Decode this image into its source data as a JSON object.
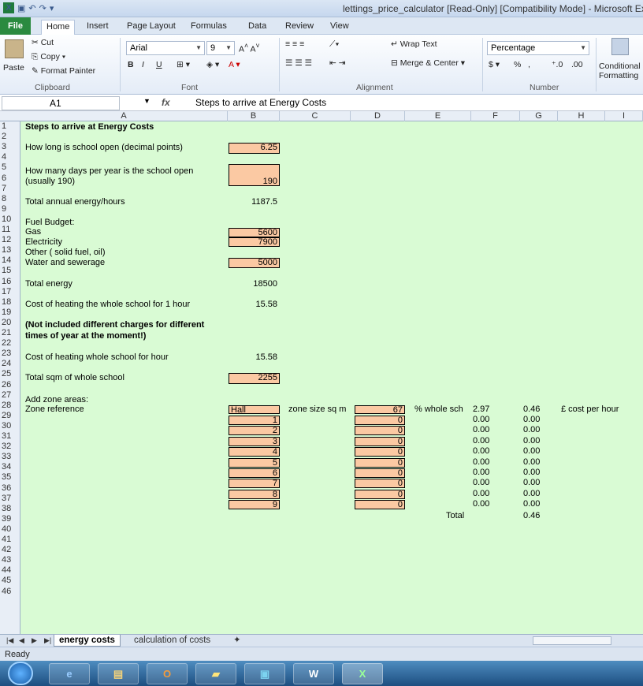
{
  "title": "lettings_price_calculator  [Read-Only]  [Compatibility Mode]  -  Microsoft Ex",
  "tabs": [
    "File",
    "Home",
    "Insert",
    "Page Layout",
    "Formulas",
    "Data",
    "Review",
    "View"
  ],
  "clipboard": {
    "cut": "Cut",
    "copy": "Copy",
    "paste": "Paste",
    "painter": "Format Painter",
    "label": "Clipboard"
  },
  "font": {
    "name": "Arial",
    "size": "9",
    "label": "Font",
    "bold": "B",
    "italic": "I",
    "underline": "U"
  },
  "alignment": {
    "wrap": "Wrap Text",
    "merge": "Merge & Center",
    "label": "Alignment"
  },
  "number": {
    "format": "Percentage",
    "label": "Number",
    "pct": "%"
  },
  "styles": {
    "cond": "Conditional",
    "cond2": "Formatting"
  },
  "namebox": "A1",
  "fx": "fx",
  "formula": "Steps to arrive at Energy Costs",
  "columns": [
    "A",
    "B",
    "C",
    "D",
    "E",
    "F",
    "G",
    "H",
    "I"
  ],
  "cells": {
    "r1": "Steps to arrive at Energy Costs",
    "r3": "How long is school open (decimal points)",
    "b3": "6.25",
    "r5a": "How many days per year is the school open",
    "r5b": "(usually 190)",
    "b5": "190",
    "r7": "Total annual energy/hours",
    "b7": "1187.5",
    "r9": "Fuel Budget:",
    "r10": "Gas",
    "b10": "5600",
    "r11": "Electricity",
    "b11": "7900",
    "r12": "Other ( solid fuel, oil)",
    "r13": "Water and sewerage",
    "b13": "5000",
    "r15": "Total energy",
    "b15": "18500",
    "r17": "Cost of heating the whole school for 1 hour",
    "b17": "15.58",
    "r19a": "(Not included different charges for different",
    "r19b": "times of year at the moment!)",
    "r21": "Cost of heating whole school for hour",
    "b21": "15.58",
    "r23": "Total sqm of whole school",
    "b23": "2255",
    "r25": "Add zone areas:",
    "r26": "Zone reference",
    "b26": "Hall",
    "c26": "zone size sq m",
    "d26": "67",
    "e26": "% whole sch",
    "f26": "2.97",
    "g26": "0.46",
    "h26": "£ cost per hour",
    "e36": "Total",
    "g36": "0.46"
  },
  "zones": [
    {
      "ref": "1",
      "size": "0",
      "pct": "0.00",
      "cost": "0.00"
    },
    {
      "ref": "2",
      "size": "0",
      "pct": "0.00",
      "cost": "0.00"
    },
    {
      "ref": "3",
      "size": "0",
      "pct": "0.00",
      "cost": "0.00"
    },
    {
      "ref": "4",
      "size": "0",
      "pct": "0.00",
      "cost": "0.00"
    },
    {
      "ref": "5",
      "size": "0",
      "pct": "0.00",
      "cost": "0.00"
    },
    {
      "ref": "6",
      "size": "0",
      "pct": "0.00",
      "cost": "0.00"
    },
    {
      "ref": "7",
      "size": "0",
      "pct": "0.00",
      "cost": "0.00"
    },
    {
      "ref": "8",
      "size": "0",
      "pct": "0.00",
      "cost": "0.00"
    },
    {
      "ref": "9",
      "size": "0",
      "pct": "0.00",
      "cost": "0.00"
    }
  ],
  "sheets": [
    "energy costs",
    "calculation of costs"
  ],
  "status": "Ready"
}
